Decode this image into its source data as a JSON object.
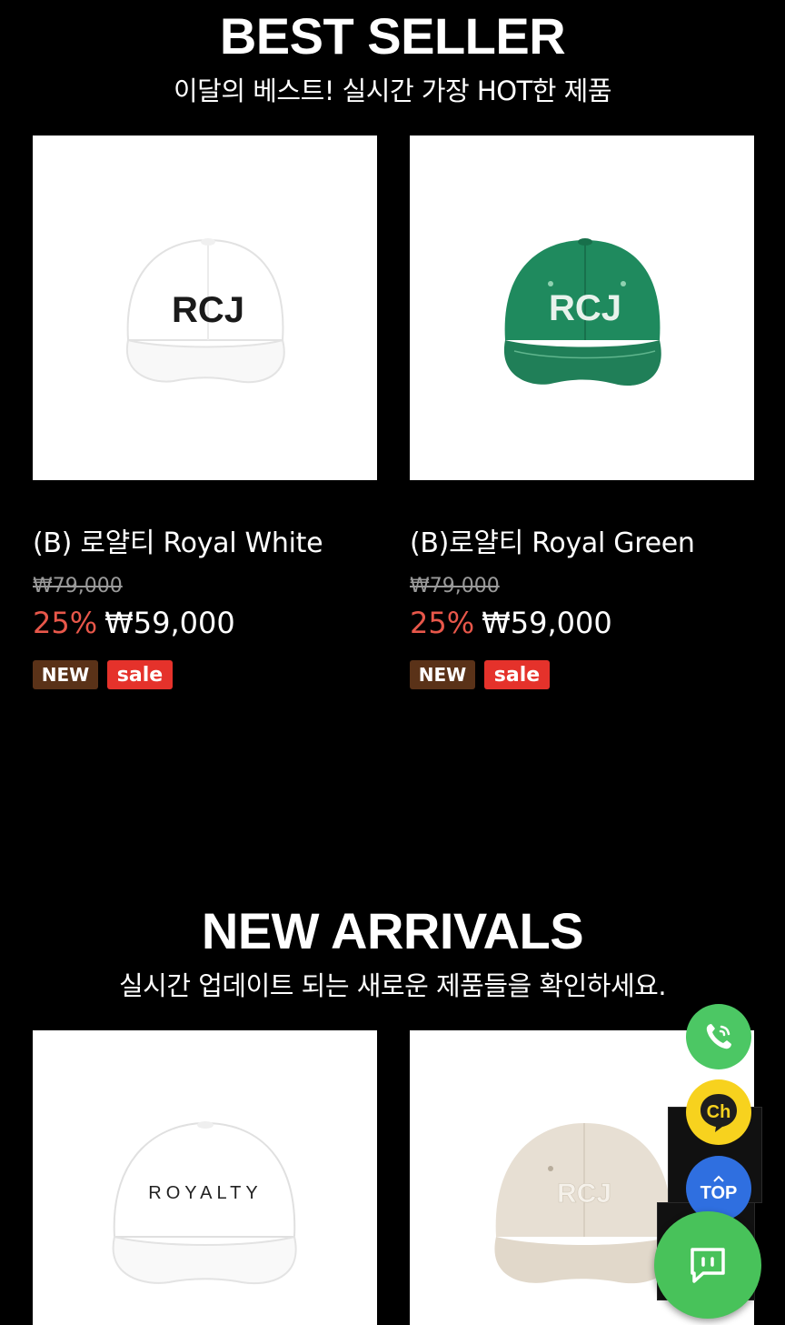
{
  "best_seller": {
    "title": "BEST SELLER",
    "subtitle": "이달의 베스트! 실시간 가장 HOT한 제품",
    "products": [
      {
        "name": "(B) 로얄티 Royal White",
        "original_price": "₩79,000",
        "discount": "25%",
        "price": "₩59,000",
        "badges": [
          "NEW",
          "sale"
        ],
        "cap_color": "#ffffff",
        "logo_color": "#1a1a1a",
        "logo_text": "RCJ"
      },
      {
        "name": "(B)로얄티 Royal Green",
        "original_price": "₩79,000",
        "discount": "25%",
        "price": "₩59,000",
        "badges": [
          "NEW",
          "sale"
        ],
        "cap_color": "#1f8a5e",
        "logo_color": "#e8f2ec",
        "logo_text": "RCJ"
      }
    ]
  },
  "new_arrivals": {
    "title": "NEW ARRIVALS",
    "subtitle": "실시간 업데이트 되는 새로운 제품들을 확인하세요.",
    "products": [
      {
        "cap_color": "#ffffff",
        "logo_text": "ROYALTY",
        "logo_color": "#222222"
      },
      {
        "cap_color": "#e7dfd3",
        "logo_text": "RCJ",
        "logo_color": "#f5f1ea"
      }
    ]
  },
  "floating": {
    "call_icon": "phone-icon",
    "channel_label": "Ch",
    "top_label": "TOP",
    "chat_icon": "chat-icon",
    "colors": {
      "call": "#4cc764",
      "channel": "#f7d21e",
      "top": "#2f6fe0",
      "chat": "#48c25a"
    }
  },
  "colors": {
    "discount": "#e8574a",
    "badge_new": "#5a3218",
    "badge_sale": "#e5322b"
  }
}
